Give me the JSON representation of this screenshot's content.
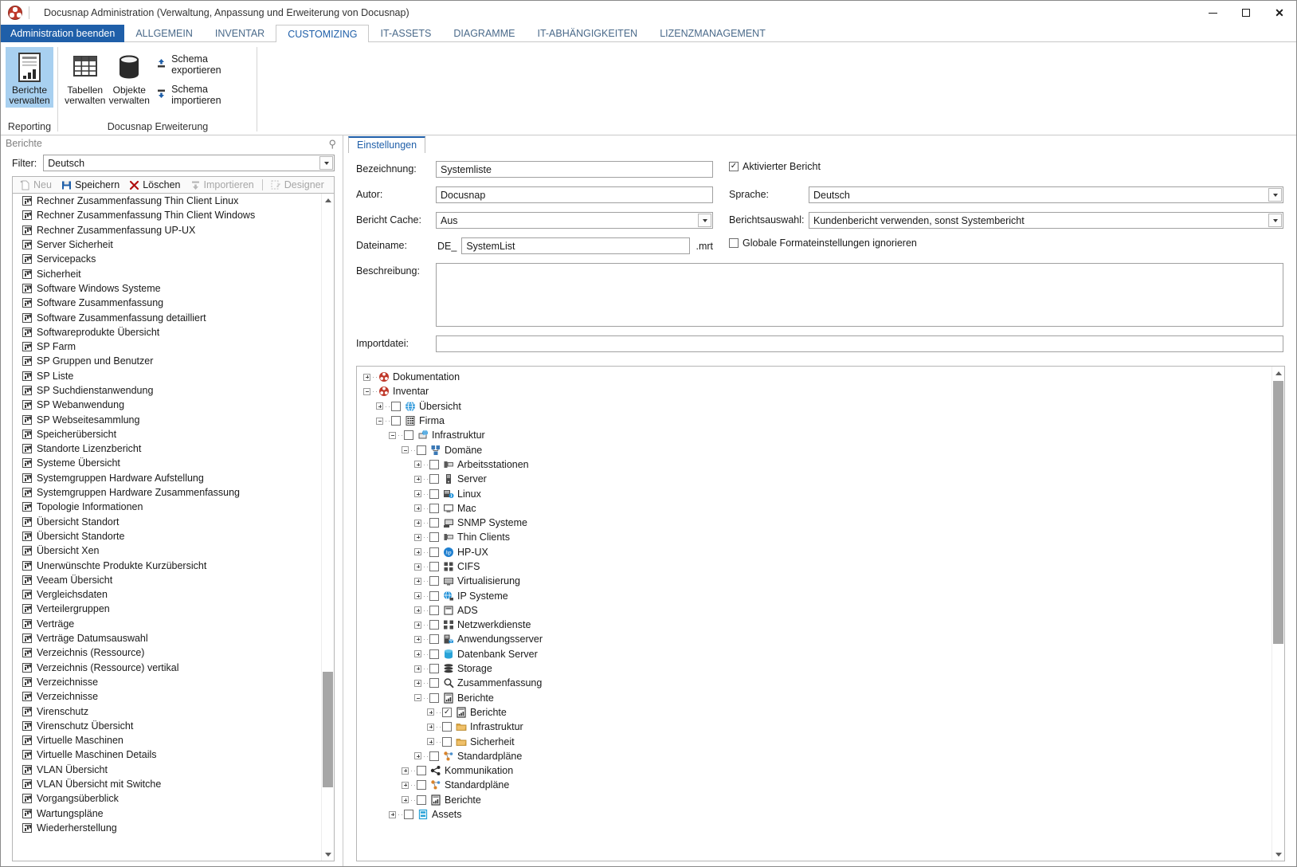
{
  "window": {
    "title": "Docusnap Administration (Verwaltung, Anpassung und Erweiterung von Docusnap)",
    "minimize": "–",
    "maximize": "□",
    "close": "✕"
  },
  "ribbon": {
    "backstage_tab": "Administration beenden",
    "tabs": [
      {
        "label": "ALLGEMEIN",
        "active": false
      },
      {
        "label": "INVENTAR",
        "active": false
      },
      {
        "label": "CUSTOMIZING",
        "active": true
      },
      {
        "label": "IT-ASSETS",
        "active": false
      },
      {
        "label": "DIAGRAMME",
        "active": false
      },
      {
        "label": "IT-ABHÄNGIGKEITEN",
        "active": false
      },
      {
        "label": "LIZENZMANAGEMENT",
        "active": false
      }
    ],
    "groups": [
      {
        "label": "Reporting",
        "buttons": [
          {
            "line1": "Berichte",
            "line2": "verwalten",
            "icon": "report-icon",
            "selected": true
          }
        ]
      },
      {
        "label": "Docusnap Erweiterung",
        "buttons": [
          {
            "line1": "Tabellen",
            "line2": "verwalten",
            "icon": "table-icon",
            "selected": false
          },
          {
            "line1": "Objekte",
            "line2": "verwalten",
            "icon": "database-icon",
            "selected": false
          }
        ],
        "small_buttons": [
          {
            "label": "Schema exportieren",
            "icon": "export-up-icon"
          },
          {
            "label": "Schema importieren",
            "icon": "import-down-icon"
          }
        ]
      }
    ]
  },
  "left_panel": {
    "caption": "Berichte",
    "pin": "⚲",
    "filter": {
      "label": "Filter:",
      "value": "Deutsch"
    },
    "toolbar": [
      {
        "label": "Neu",
        "icon": "new-icon",
        "disabled": true
      },
      {
        "label": "Speichern",
        "icon": "save-icon",
        "disabled": false
      },
      {
        "label": "Löschen",
        "icon": "delete-icon",
        "disabled": false
      },
      {
        "label": "Importieren",
        "icon": "import-icon",
        "disabled": true
      },
      {
        "label": "Designer",
        "icon": "designer-icon",
        "disabled": true
      }
    ],
    "reports": [
      "Rechner Zusammenfassung Thin Client Linux",
      "Rechner Zusammenfassung Thin Client Windows",
      "Rechner Zusammenfassung UP-UX",
      "Server Sicherheit",
      "Servicepacks",
      "Sicherheit",
      "Software Windows Systeme",
      "Software Zusammenfassung",
      "Software Zusammenfassung detailliert",
      "Softwareprodukte Übersicht",
      "SP Farm",
      "SP Gruppen und Benutzer",
      "SP Liste",
      "SP Suchdienstanwendung",
      "SP Webanwendung",
      "SP Webseitesammlung",
      "Speicherübersicht",
      "Standorte Lizenzbericht",
      "Systeme Übersicht",
      "Systemgruppen Hardware Aufstellung",
      "Systemgruppen Hardware Zusammenfassung",
      "Topologie Informationen",
      "Übersicht Standort",
      "Übersicht Standorte",
      "Übersicht Xen",
      "Unerwünschte Produkte Kurzübersicht",
      "Veeam Übersicht",
      "Vergleichsdaten",
      "Verteilergruppen",
      "Verträge",
      "Verträge Datumsauswahl",
      "Verzeichnis (Ressource)",
      "Verzeichnis (Ressource) vertikal",
      "Verzeichnisse",
      "Verzeichnisse",
      "Virenschutz",
      "Virenschutz Übersicht",
      "Virtuelle Maschinen",
      "Virtuelle Maschinen Details",
      "VLAN Übersicht",
      "VLAN Übersicht mit Switche",
      "Vorgangsüberblick",
      "Wartungspläne",
      "Wiederherstellung"
    ]
  },
  "right_panel": {
    "tab": "Einstellungen",
    "fields": {
      "bezeichnung_label": "Bezeichnung:",
      "bezeichnung_value": "Systemliste",
      "autor_label": "Autor:",
      "autor_value": "Docusnap",
      "cache_label": "Bericht Cache:",
      "cache_value": "Aus",
      "dateiname_label": "Dateiname:",
      "dateiname_prefix": "DE_",
      "dateiname_value": "SystemList",
      "dateiname_suffix": ".mrt",
      "beschreibung_label": "Beschreibung:",
      "beschreibung_value": "",
      "importdatei_label": "Importdatei:",
      "importdatei_value": ""
    },
    "options": {
      "aktiviert_label": "Aktivierter Bericht",
      "aktiviert_checked": true,
      "sprache_label": "Sprache:",
      "sprache_value": "Deutsch",
      "berichtsauswahl_label": "Berichtsauswahl:",
      "berichtsauswahl_value": "Kundenbericht verwenden, sonst Systembericht",
      "globale_label": "Globale Formateinstellungen ignorieren",
      "globale_checked": false
    },
    "tree": [
      {
        "label": "Dokumentation",
        "depth": 0,
        "expander": "plus",
        "checkbox": null,
        "icon": "docusnap-icon"
      },
      {
        "label": "Inventar",
        "depth": 0,
        "expander": "minus",
        "checkbox": null,
        "icon": "docusnap-icon"
      },
      {
        "label": "Übersicht",
        "depth": 1,
        "expander": "plus",
        "checkbox": false,
        "icon": "globe-icon"
      },
      {
        "label": "Firma",
        "depth": 1,
        "expander": "minus",
        "checkbox": false,
        "icon": "building-icon"
      },
      {
        "label": "Infrastruktur",
        "depth": 2,
        "expander": "minus",
        "checkbox": false,
        "icon": "infrastructure-icon"
      },
      {
        "label": "Domäne",
        "depth": 3,
        "expander": "minus",
        "checkbox": false,
        "icon": "domain-icon"
      },
      {
        "label": "Arbeitsstationen",
        "depth": 4,
        "expander": "plus",
        "checkbox": false,
        "icon": "workstation-icon"
      },
      {
        "label": "Server",
        "depth": 4,
        "expander": "plus",
        "checkbox": false,
        "icon": "server-icon"
      },
      {
        "label": "Linux",
        "depth": 4,
        "expander": "plus",
        "checkbox": false,
        "icon": "linux-icon"
      },
      {
        "label": "Mac",
        "depth": 4,
        "expander": "plus",
        "checkbox": false,
        "icon": "mac-icon"
      },
      {
        "label": "SNMP Systeme",
        "depth": 4,
        "expander": "plus",
        "checkbox": false,
        "icon": "snmp-icon"
      },
      {
        "label": "Thin Clients",
        "depth": 4,
        "expander": "plus",
        "checkbox": false,
        "icon": "thinclient-icon"
      },
      {
        "label": "HP-UX",
        "depth": 4,
        "expander": "plus",
        "checkbox": false,
        "icon": "hp-icon"
      },
      {
        "label": "CIFS",
        "depth": 4,
        "expander": "plus",
        "checkbox": false,
        "icon": "cifs-icon"
      },
      {
        "label": "Virtualisierung",
        "depth": 4,
        "expander": "plus",
        "checkbox": false,
        "icon": "virtualization-icon"
      },
      {
        "label": "IP Systeme",
        "depth": 4,
        "expander": "plus",
        "checkbox": false,
        "icon": "ipsystem-icon"
      },
      {
        "label": "ADS",
        "depth": 4,
        "expander": "plus",
        "checkbox": false,
        "icon": "ads-icon"
      },
      {
        "label": "Netzwerkdienste",
        "depth": 4,
        "expander": "plus",
        "checkbox": false,
        "icon": "netservice-icon"
      },
      {
        "label": "Anwendungsserver",
        "depth": 4,
        "expander": "plus",
        "checkbox": false,
        "icon": "appserver-icon"
      },
      {
        "label": "Datenbank Server",
        "depth": 4,
        "expander": "plus",
        "checkbox": false,
        "icon": "dbserver-icon"
      },
      {
        "label": "Storage",
        "depth": 4,
        "expander": "plus",
        "checkbox": false,
        "icon": "storage-icon"
      },
      {
        "label": "Zusammenfassung",
        "depth": 4,
        "expander": "plus",
        "checkbox": false,
        "icon": "magnifier-icon"
      },
      {
        "label": "Berichte",
        "depth": 4,
        "expander": "minus",
        "checkbox": false,
        "icon": "report-icon"
      },
      {
        "label": "Berichte",
        "depth": 5,
        "expander": "plus",
        "checkbox": true,
        "icon": "report-icon"
      },
      {
        "label": "Infrastruktur",
        "depth": 5,
        "expander": "plus",
        "checkbox": false,
        "icon": "folder-icon"
      },
      {
        "label": "Sicherheit",
        "depth": 5,
        "expander": "plus",
        "checkbox": false,
        "icon": "folder-icon"
      },
      {
        "label": "Standardpläne",
        "depth": 4,
        "expander": "plus",
        "checkbox": false,
        "icon": "plan-icon"
      },
      {
        "label": "Kommunikation",
        "depth": 3,
        "expander": "plus",
        "checkbox": false,
        "icon": "share-icon"
      },
      {
        "label": "Standardpläne",
        "depth": 3,
        "expander": "plus",
        "checkbox": false,
        "icon": "plan-icon"
      },
      {
        "label": "Berichte",
        "depth": 3,
        "expander": "plus",
        "checkbox": false,
        "icon": "report-icon"
      },
      {
        "label": "Assets",
        "depth": 2,
        "expander": "plus",
        "checkbox": false,
        "icon": "assets-icon"
      }
    ]
  },
  "colors": {
    "accent": "#1f5fa9",
    "backstage": "#1f5fa9",
    "selection": "#a8d0f0",
    "brand_red": "#c0392b",
    "folder_gold": "#d9a441"
  }
}
